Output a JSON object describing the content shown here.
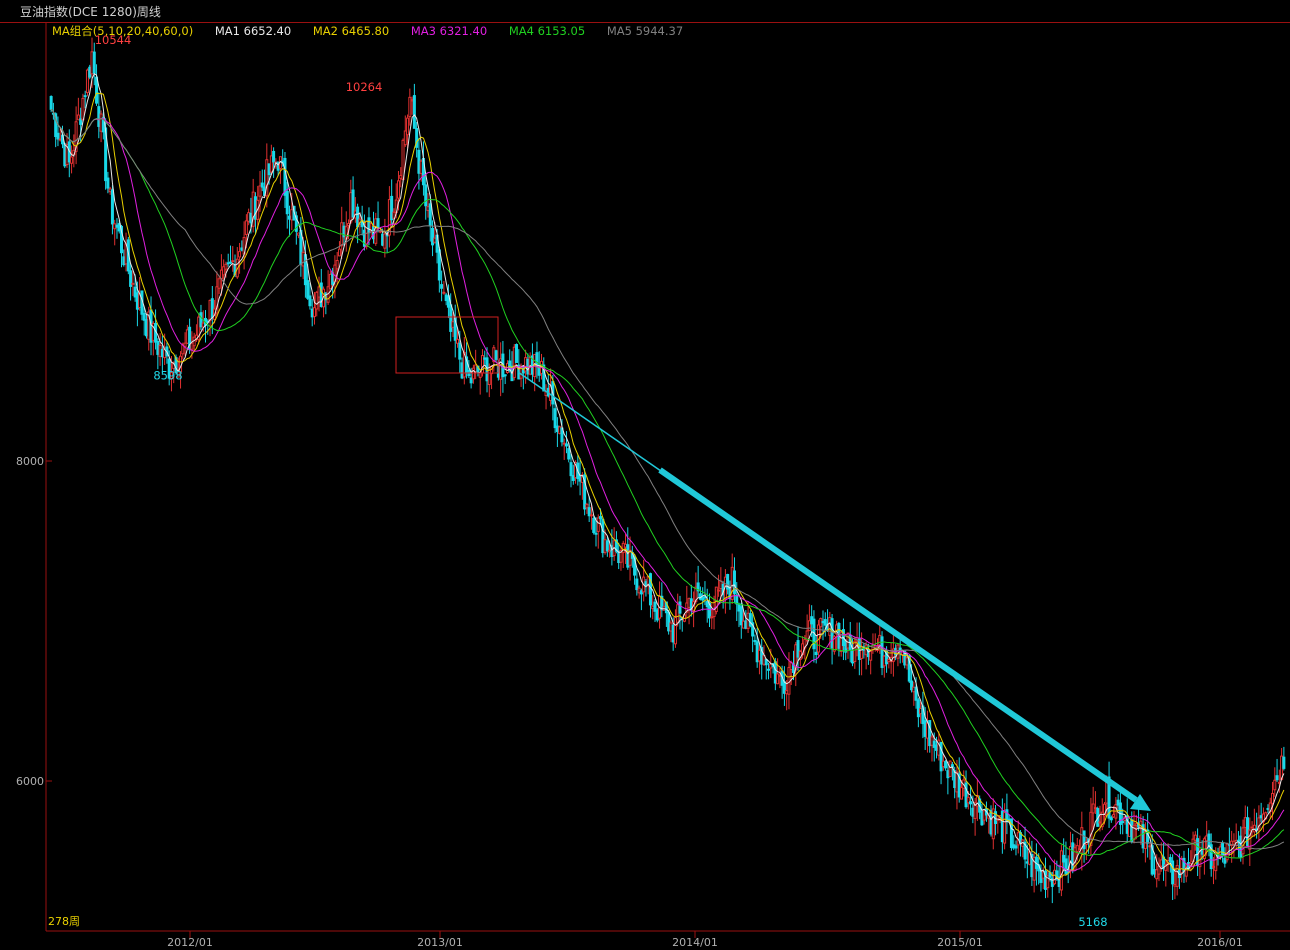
{
  "header": {
    "title": "豆油指数(DCE 1280)周线"
  },
  "legend": {
    "group_label": "MA组合(5,10,20,40,60,0)",
    "items": [
      {
        "label": "MA1 6652.40",
        "color": "#e8e8e8"
      },
      {
        "label": "MA2 6465.80",
        "color": "#e8d000"
      },
      {
        "label": "MA3 6321.40",
        "color": "#e020e0"
      },
      {
        "label": "MA4 6153.05",
        "color": "#20d020"
      },
      {
        "label": "MA5 5944.37",
        "color": "#808080"
      }
    ]
  },
  "colors": {
    "up": "#e03030",
    "down": "#18d8e8",
    "frame": "#9a1010",
    "trend_arrow": "#20c8d8",
    "box": "#d02020"
  },
  "chart_data": {
    "type": "candlestick",
    "ylim": [
      5000,
      10800
    ],
    "yticks": [
      {
        "label": "8000",
        "value": 8000
      },
      {
        "label": "6000",
        "value": 6000
      }
    ],
    "xticks": [
      "2012/01",
      "2013/01",
      "2014/01",
      "2015/01",
      "2016/01"
    ],
    "period_label": "278周",
    "annotations": [
      {
        "text": "10544",
        "value": 10544,
        "color": "#ff4040"
      },
      {
        "text": "8598",
        "value": 8598,
        "color": "#20d8e8"
      },
      {
        "text": "10264",
        "value": 10264,
        "color": "#ff4040"
      },
      {
        "text": "5168",
        "value": 5168,
        "color": "#20d8e8"
      }
    ],
    "close_path": [
      [
        0,
        10200
      ],
      [
        8,
        9850
      ],
      [
        18,
        10544
      ],
      [
        26,
        9600
      ],
      [
        36,
        9100
      ],
      [
        44,
        8800
      ],
      [
        52,
        8598
      ],
      [
        62,
        8750
      ],
      [
        72,
        9000
      ],
      [
        82,
        9300
      ],
      [
        92,
        9700
      ],
      [
        100,
        9900
      ],
      [
        108,
        9400
      ],
      [
        116,
        8950
      ],
      [
        124,
        9200
      ],
      [
        132,
        9650
      ],
      [
        138,
        9450
      ],
      [
        146,
        9400
      ],
      [
        152,
        9700
      ],
      [
        158,
        10264
      ],
      [
        166,
        9500
      ],
      [
        176,
        8800
      ],
      [
        184,
        8500
      ],
      [
        192,
        8600
      ],
      [
        200,
        8600
      ],
      [
        208,
        8620
      ],
      [
        216,
        8550
      ],
      [
        222,
        8300
      ],
      [
        228,
        8050
      ],
      [
        236,
        7750
      ],
      [
        244,
        7500
      ],
      [
        252,
        7400
      ],
      [
        260,
        7250
      ],
      [
        266,
        7100
      ],
      [
        274,
        6950
      ],
      [
        282,
        7150
      ],
      [
        292,
        7100
      ],
      [
        300,
        7250
      ],
      [
        308,
        6900
      ],
      [
        316,
        6750
      ],
      [
        322,
        6600
      ],
      [
        330,
        6900
      ],
      [
        338,
        6900
      ],
      [
        346,
        6950
      ],
      [
        352,
        6800
      ],
      [
        358,
        6900
      ],
      [
        366,
        6800
      ],
      [
        374,
        6900
      ],
      [
        380,
        6500
      ],
      [
        386,
        6300
      ],
      [
        394,
        6100
      ],
      [
        402,
        5950
      ],
      [
        412,
        5800
      ],
      [
        420,
        5700
      ],
      [
        428,
        5550
      ],
      [
        436,
        5400
      ],
      [
        444,
        5450
      ],
      [
        450,
        5500
      ],
      [
        456,
        5700
      ],
      [
        464,
        5900
      ],
      [
        472,
        5800
      ],
      [
        480,
        5650
      ],
      [
        486,
        5500
      ],
      [
        492,
        5400
      ],
      [
        498,
        5450
      ],
      [
        506,
        5600
      ],
      [
        512,
        5500
      ],
      [
        520,
        5550
      ],
      [
        528,
        5700
      ],
      [
        536,
        5900
      ],
      [
        543,
        6150
      ]
    ],
    "ma_periods": [
      5,
      10,
      20,
      40,
      60
    ]
  }
}
